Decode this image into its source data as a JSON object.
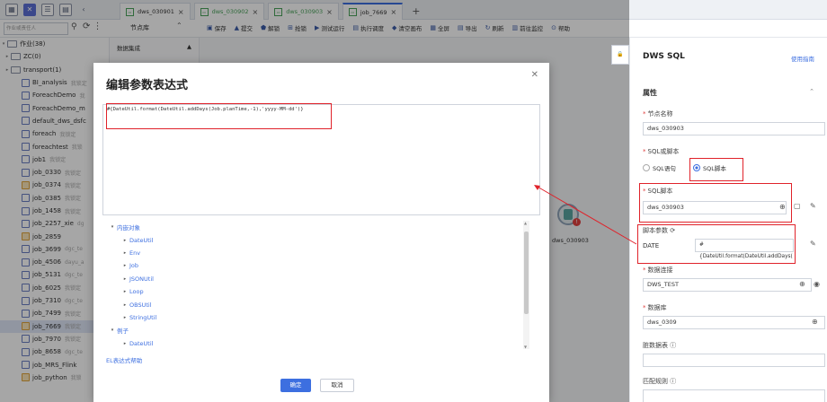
{
  "tabs": [
    {
      "label": "dws_030901",
      "style": "normal"
    },
    {
      "label": "dws_030902",
      "style": "dim"
    },
    {
      "label": "dws_030903",
      "style": "dim"
    },
    {
      "label": "job_7669",
      "style": "active"
    }
  ],
  "left": {
    "search_placeholder": "作业或责任人",
    "root": "作业(38)",
    "folders": [
      "ZC(0)",
      "transport(1)"
    ],
    "jobs": [
      {
        "name": "BI_analysis",
        "tag": "我锁定"
      },
      {
        "name": "ForeachDemo",
        "tag": "我"
      },
      {
        "name": "ForeachDemo_m",
        "tag": ""
      },
      {
        "name": "default_dws_dsfc",
        "tag": ""
      },
      {
        "name": "foreach",
        "tag": "我锁定"
      },
      {
        "name": "foreachtest",
        "tag": "我锁"
      },
      {
        "name": "job1",
        "tag": "我锁定"
      },
      {
        "name": "job_0330",
        "tag": "我锁定"
      },
      {
        "name": "job_0374",
        "tag": "我锁定"
      },
      {
        "name": "job_0385",
        "tag": "我锁定"
      },
      {
        "name": "job_1458",
        "tag": "我锁定"
      },
      {
        "name": "job_2257_xie",
        "tag": "dg"
      },
      {
        "name": "job_2859",
        "tag": ""
      },
      {
        "name": "job_3699",
        "tag": "dgc_te"
      },
      {
        "name": "job_4506",
        "tag": "dayu_a"
      },
      {
        "name": "job_5131",
        "tag": "dgc_te"
      },
      {
        "name": "job_6025",
        "tag": "我锁定"
      },
      {
        "name": "job_7310",
        "tag": "dgc_te"
      },
      {
        "name": "job_7499",
        "tag": "我锁定"
      },
      {
        "name": "job_7669",
        "tag": "我锁定"
      },
      {
        "name": "job_7970",
        "tag": "我锁定"
      },
      {
        "name": "job_8658",
        "tag": "dgc_te"
      },
      {
        "name": "job_MRS_Flink",
        "tag": ""
      },
      {
        "name": "job_python",
        "tag": "我锁"
      }
    ]
  },
  "toolbar": {
    "node_lib": "节点库",
    "data_integration": "数据集成",
    "actions": [
      "保存",
      "提交",
      "解锁",
      "抢锁",
      "测试运行",
      "执行调度",
      "清空画布",
      "全屏",
      "导出",
      "刷新",
      "前往监控",
      "帮助"
    ]
  },
  "canvas": {
    "node_label": "dws_030903",
    "badge": "!"
  },
  "modal": {
    "title": "编辑参数表达式",
    "expression": "#{DateUtil.format(DateUtil.addDays(Job.planTime,-1),'yyyy-MM-dd')}",
    "tree": [
      {
        "label": "内嵌对象",
        "level": 1,
        "expanded": true
      },
      {
        "label": "DateUtil",
        "level": 2
      },
      {
        "label": "Env",
        "level": 2
      },
      {
        "label": "Job",
        "level": 2
      },
      {
        "label": "JSONUtil",
        "level": 2
      },
      {
        "label": "Loop",
        "level": 2
      },
      {
        "label": "OBSUtil",
        "level": 2
      },
      {
        "label": "StringUtil",
        "level": 2
      },
      {
        "label": "例子",
        "level": 1,
        "expanded": true
      },
      {
        "label": "DateUtil",
        "level": 2
      }
    ],
    "help_link": "EL表达式帮助",
    "ok": "确定",
    "cancel": "取消"
  },
  "panel": {
    "title": "DWS SQL",
    "guide": "使用指南",
    "section": "属性",
    "node_name_label": "节点名称",
    "node_name_value": "dws_030903",
    "sql_type_label": "SQL或脚本",
    "sql_statement": "SQL语句",
    "sql_script": "SQL脚本",
    "script_label": "SQL脚本",
    "script_value": "dws_030903",
    "params_label": "脚本参数",
    "param_key": "DATE",
    "param_value": "#{DateUtil.format(DateUtil.addDays(",
    "conn_label": "数据连接",
    "conn_value": "DWS_TEST",
    "db_label": "数据库",
    "db_value": "dws_0309",
    "tail_label": "脏数据表",
    "match_label": "匹配规则"
  }
}
